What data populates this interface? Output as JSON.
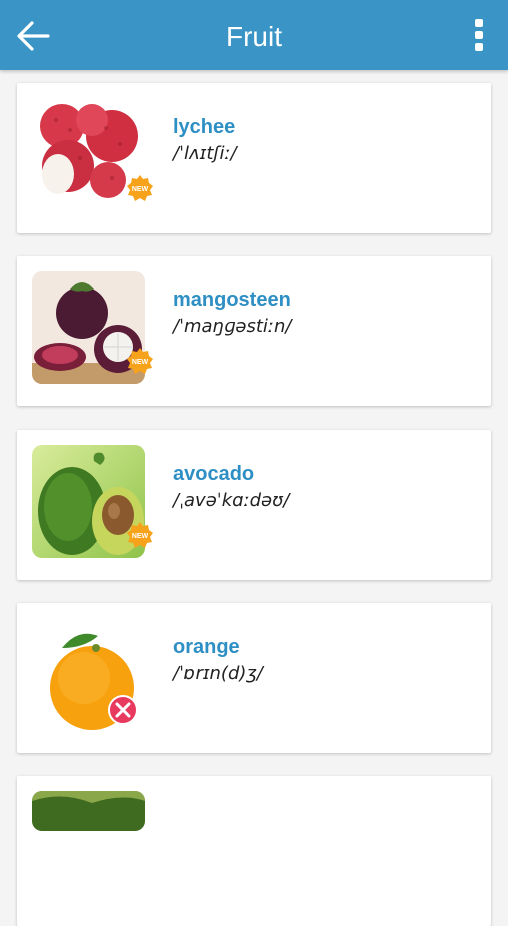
{
  "header": {
    "title": "Fruit",
    "back_icon": "arrow-left-icon",
    "menu_icon": "more-vertical-icon",
    "color": "#3a95c6"
  },
  "items": [
    {
      "word": "lychee",
      "ipa": "/ˈlʌɪtʃiː/",
      "badge": "NEW"
    },
    {
      "word": "mangosteen",
      "ipa": "/ˈmaŋɡəstiːn/",
      "badge": "NEW"
    },
    {
      "word": "avocado",
      "ipa": "/ˌavəˈkɑːdəʊ/",
      "badge": "NEW"
    },
    {
      "word": "orange",
      "ipa": "/ˈɒrɪn(d)ʒ/",
      "badge": "remove"
    }
  ],
  "colors": {
    "word": "#2e8fc4",
    "badge_new": "#f7a21b",
    "badge_remove": "#e83a5f"
  }
}
